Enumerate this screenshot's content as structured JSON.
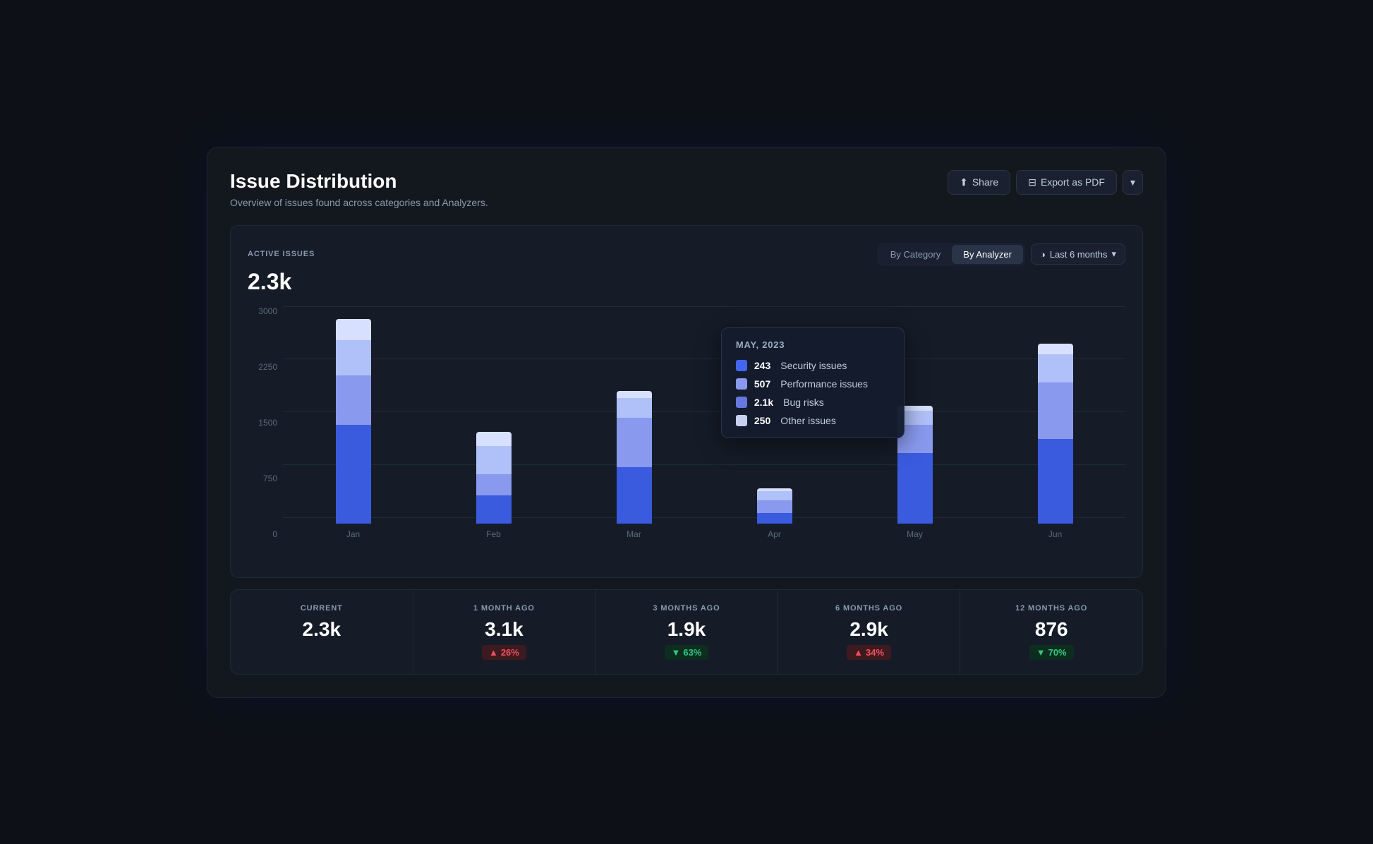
{
  "page": {
    "title": "Issue Distribution",
    "subtitle": "Overview of issues found across categories and Analyzers."
  },
  "header": {
    "share_label": "Share",
    "export_label": "Export as PDF",
    "chevron": "▾"
  },
  "chart": {
    "active_issues_label": "ACTIVE ISSUES",
    "active_issues_value": "2.3k",
    "tab_category": "By Category",
    "tab_analyzer": "By Analyzer",
    "time_icon": "🕐",
    "time_label": "Last 6 months",
    "y_labels": [
      "0",
      "750",
      "1500",
      "2250",
      "3000"
    ],
    "months": [
      "Jan",
      "Feb",
      "Mar",
      "Apr",
      "May",
      "Jun"
    ],
    "bars": [
      {
        "month": "Jan",
        "segments": [
          {
            "value": 1400,
            "color": "#3a5bde",
            "pct": 48
          },
          {
            "value": 700,
            "color": "#8899ee",
            "pct": 24
          },
          {
            "value": 500,
            "color": "#b0c0f8",
            "pct": 17
          },
          {
            "value": 300,
            "color": "#d8e0ff",
            "pct": 10
          }
        ],
        "total": 2900
      },
      {
        "month": "Feb",
        "segments": [
          {
            "value": 400,
            "color": "#3a5bde",
            "pct": 30
          },
          {
            "value": 300,
            "color": "#8899ee",
            "pct": 23
          },
          {
            "value": 400,
            "color": "#b0c0f8",
            "pct": 31
          },
          {
            "value": 200,
            "color": "#d8e0ff",
            "pct": 15
          }
        ],
        "total": 1300
      },
      {
        "month": "Mar",
        "segments": [
          {
            "value": 800,
            "color": "#3a5bde",
            "pct": 43
          },
          {
            "value": 700,
            "color": "#8899ee",
            "pct": 37
          },
          {
            "value": 280,
            "color": "#b0c0f8",
            "pct": 15
          },
          {
            "value": 100,
            "color": "#d8e0ff",
            "pct": 5
          }
        ],
        "total": 1880
      },
      {
        "month": "Apr",
        "segments": [
          {
            "value": 150,
            "color": "#3a5bde",
            "pct": 30
          },
          {
            "value": 180,
            "color": "#8899ee",
            "pct": 36
          },
          {
            "value": 130,
            "color": "#b0c0f8",
            "pct": 26
          },
          {
            "value": 40,
            "color": "#d8e0ff",
            "pct": 8
          }
        ],
        "total": 500
      },
      {
        "month": "May",
        "segments": [
          {
            "value": 1000,
            "color": "#3a5bde",
            "pct": 60
          },
          {
            "value": 400,
            "color": "#8899ee",
            "pct": 24
          },
          {
            "value": 200,
            "color": "#b0c0f8",
            "pct": 12
          },
          {
            "value": 70,
            "color": "#d8e0ff",
            "pct": 4
          }
        ],
        "total": 1670
      },
      {
        "month": "Jun",
        "segments": [
          {
            "value": 1200,
            "color": "#3a5bde",
            "pct": 47
          },
          {
            "value": 800,
            "color": "#8899ee",
            "pct": 31
          },
          {
            "value": 400,
            "color": "#b0c0f8",
            "pct": 16
          },
          {
            "value": 150,
            "color": "#d8e0ff",
            "pct": 6
          }
        ],
        "total": 2550
      }
    ],
    "max_value": 3000
  },
  "tooltip": {
    "title": "MAY, 2023",
    "items": [
      {
        "value": "243",
        "label": "Security issues",
        "color": "#4466ee"
      },
      {
        "value": "507",
        "label": "Performance issues",
        "color": "#8899ee"
      },
      {
        "value": "2.1k",
        "label": "Bug risks",
        "color": "#6677dd"
      },
      {
        "value": "250",
        "label": "Other issues",
        "color": "#c8d0f0"
      }
    ]
  },
  "stats": [
    {
      "label": "CURRENT",
      "value": "2.3k",
      "badge": null
    },
    {
      "label": "1 MONTH AGO",
      "value": "3.1k",
      "badge": {
        "text": "26%",
        "type": "red",
        "arrow": "▲"
      }
    },
    {
      "label": "3 MONTHS AGO",
      "value": "1.9k",
      "badge": {
        "text": "63%",
        "type": "green",
        "arrow": "▼"
      }
    },
    {
      "label": "6 MONTHS AGO",
      "value": "2.9k",
      "badge": {
        "text": "34%",
        "type": "red",
        "arrow": "▲"
      }
    },
    {
      "label": "12 MONTHS AGO",
      "value": "876",
      "badge": {
        "text": "70%",
        "type": "green",
        "arrow": "▼"
      }
    }
  ]
}
